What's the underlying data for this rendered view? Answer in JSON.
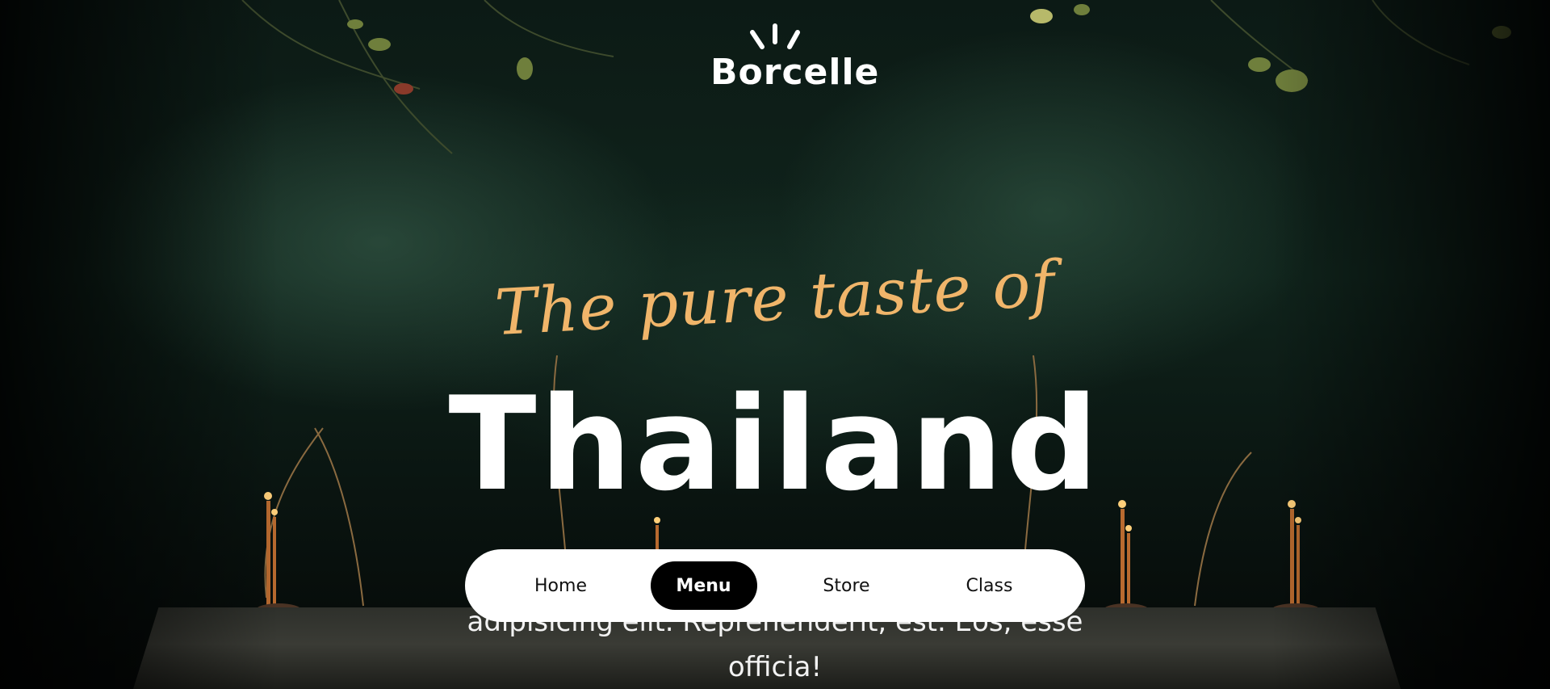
{
  "brand": {
    "logo_text": "Borcelle"
  },
  "hero": {
    "tagline": "The pure taste of",
    "headline": "Thailand",
    "body_line1": "adipisicing elit. Reprehenderit, est. Eos, esse",
    "body_line2": "officia!"
  },
  "nav": {
    "items": [
      {
        "label": "Home",
        "active": false
      },
      {
        "label": "Menu",
        "active": true
      },
      {
        "label": "Store",
        "active": false
      },
      {
        "label": "Class",
        "active": false
      }
    ]
  },
  "colors": {
    "tagline": "#f0b56a",
    "headline": "#ffffff",
    "nav_background": "#ffffff",
    "nav_active_background": "#000000"
  }
}
